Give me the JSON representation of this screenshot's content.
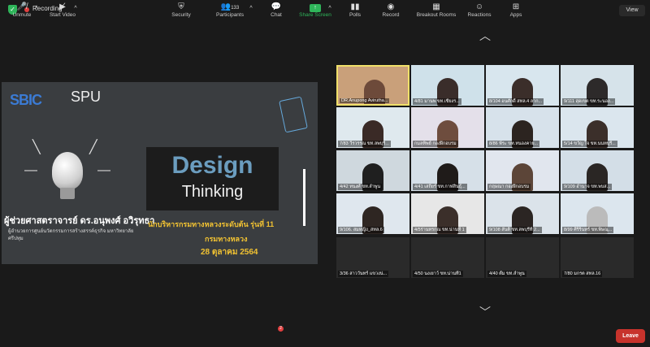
{
  "top": {
    "recording_label": "Recording",
    "view_label": "View"
  },
  "shared_screen": {
    "logo_left": "SBIC",
    "logo_right": "SPU",
    "title_line1": "Design",
    "title_line2": "Thinking",
    "presenter": "ผู้ช่วยศาสตราจารย์ ดร.อนุพงศ์ อวิรุทธา",
    "presenter_sub": "ผู้อำนวยการศูนย์นวัตกรรมการสร้างสรรค์ธุรกิจ มหาวิทยาลัยศรีปทุม",
    "course": "นักบริหารกรมทางหลวงระดับต้น รุ่นที่ 11",
    "department": "กรมทางหลวง",
    "date": "28 ตุลาคม 2564"
  },
  "gallery": {
    "tiles": [
      {
        "name": "DR.Anupong Avirutha...",
        "active": true
      },
      {
        "name": "4/81 มานพ   ขท.เชียงร..."
      },
      {
        "name": "8/104 อนศักดิ์ สทล.4 ลาก..."
      },
      {
        "name": "9/111 สุดเขต ขท.ระนอง..."
      },
      {
        "name": "7/83 วีรวรรณ  ขท.ลพบุรี..."
      },
      {
        "name": "กมลทิพย์ กองฝึกอบรม"
      },
      {
        "name": "8/86 พีระ ขท.หนองคาย..."
      },
      {
        "name": "5/14 ขวัญ ใจ ขท.นนทบุรี..."
      },
      {
        "name": "4/42 ทนงศ์ ขท.ลำพูน"
      },
      {
        "name": "4/41 เสถียร์ ขท.กาฬสินธุ์..."
      },
      {
        "name": "กฤษณา กองฝึกอบรม"
      },
      {
        "name": "9/109 อำนาจ ขท.พบส..."
      },
      {
        "name": "9/106. สมหญิง_สทล.6"
      },
      {
        "name": "4/5ร่านทรกณ ขท.น่านที่ 1"
      },
      {
        "name": "9/108 สันติ ขท.ลพบุรีที่ 2..."
      },
      {
        "name": "8/99 ศิริรินทร์ ขท.พิษณุ..."
      },
      {
        "name": "3/36 สาววันทร์ แขวงน่..."
      },
      {
        "name": "4/50 นงเยาว์ ขท.น่านที่1"
      },
      {
        "name": "4/40 ตั้ม ขท.ลำพูน"
      },
      {
        "name": "7/80 มกรต สทล.16"
      }
    ]
  },
  "toolbar": {
    "unmute": "Unmute",
    "start_video": "Start Video",
    "security": "Security",
    "participants": "Participants",
    "participants_count": "133",
    "chat": "Chat",
    "chat_badge": "2",
    "share_screen": "Share Screen",
    "polls": "Polls",
    "record": "Record",
    "breakout_rooms": "Breakout Rooms",
    "reactions": "Reactions",
    "apps": "Apps",
    "leave": "Leave"
  },
  "colors": {
    "share_accent": "#2fb55a",
    "leave_red": "#c7332c",
    "highlight_yellow": "#f0e06a",
    "slide_gold": "#f1c232"
  }
}
